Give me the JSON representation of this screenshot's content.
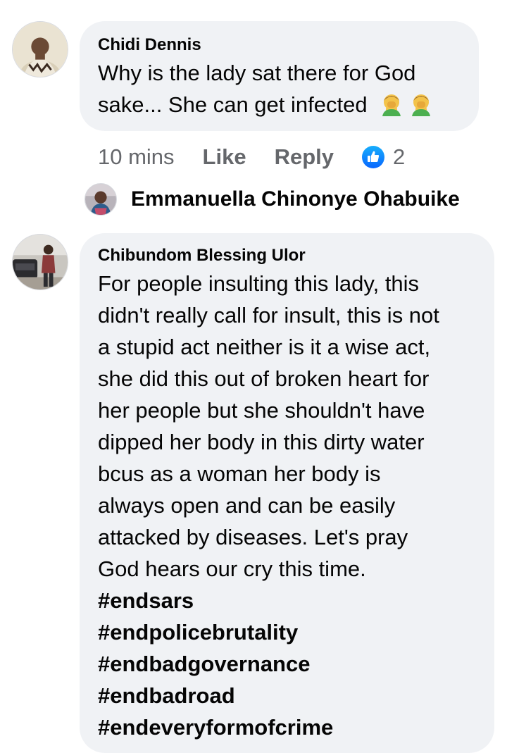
{
  "comments": [
    {
      "author": "Chidi Dennis",
      "text_lines": [
        "Why is the lady sat there for God",
        "sake... She can get infected"
      ],
      "emoji": [
        "man-facepalming-emoji",
        "man-facepalming-emoji"
      ],
      "time": "10 mins",
      "like_label": "Like",
      "reply_label": "Reply",
      "reaction_count": "2",
      "reaction_icon": "thumbs-up-icon",
      "reply_preview_author": "Emmanuella Chinonye Ohabuike"
    },
    {
      "author": "Chibundom Blessing Ulor",
      "text_lines": [
        "For people insulting this lady, this",
        "didn't really call for insult, this is not",
        "a stupid act neither is it a wise act,",
        "she did this out of broken heart for",
        "her people but she shouldn't have",
        "dipped her body in this dirty water",
        "bcus as a woman her body is",
        "always open and can be easily",
        "attacked by diseases. Let's pray",
        "God hears our cry this time."
      ],
      "hashtags": [
        "#endsars",
        "#endpolicebrutality",
        "#endbadgovernance",
        "#endbadroad",
        "#endeveryformofcrime"
      ]
    }
  ],
  "colors": {
    "bubble": "#f0f2f5",
    "text": "#050505",
    "secondary": "#65676b",
    "like_blue": "#0866ff"
  }
}
